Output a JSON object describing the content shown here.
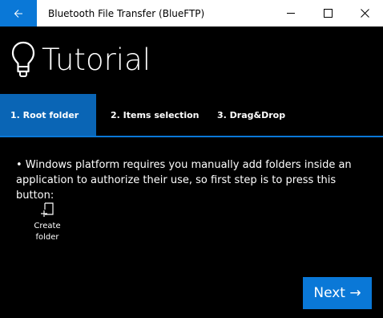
{
  "window": {
    "title": "Bluetooth File Transfer (BlueFTP)",
    "accent_color": "#0a78d7",
    "controls": {
      "minimize": "minimize-icon",
      "maximize": "maximize-icon",
      "close": "close-icon"
    }
  },
  "header": {
    "title": "Tutorial",
    "icon": "lightbulb-icon"
  },
  "tabs": [
    {
      "label": "1. Root folder",
      "active": true
    },
    {
      "label": "2. Items selection",
      "active": false
    },
    {
      "label": "3. Drag&Drop",
      "active": false
    }
  ],
  "content": {
    "instructions": "• Windows platform requires you manually add folders inside an application to authorize their use, so first step is to press this button:",
    "create_folder": {
      "label": "Create folder",
      "icon": "create-folder-icon"
    }
  },
  "footer": {
    "next_label": "Next →"
  }
}
